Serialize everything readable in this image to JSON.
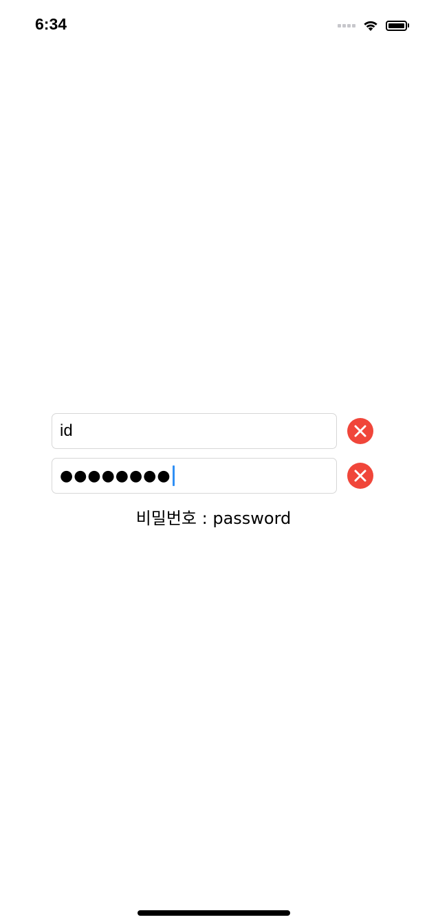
{
  "status_bar": {
    "time": "6:34",
    "signal_icon": "cellular-signal-icon",
    "wifi_icon": "wifi-icon",
    "battery_icon": "battery-icon",
    "battery_level": 1.0
  },
  "form": {
    "id_field": {
      "value": "id",
      "clear_icon": "clear-circle-icon"
    },
    "password_field": {
      "masked_value": "●●●●●●●●",
      "clear_icon": "clear-circle-icon"
    },
    "hint": "비밀번호 : password"
  },
  "colors": {
    "clear_button": "#f0463a",
    "cursor": "#2f8ff5",
    "field_border": "#d6d6d6"
  }
}
